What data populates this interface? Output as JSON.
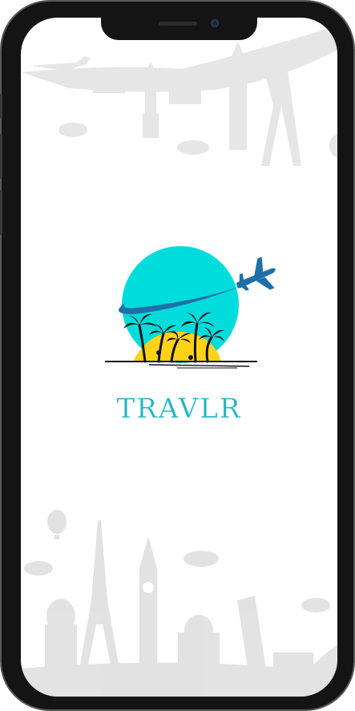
{
  "app": {
    "brand_name": "TRAVLR"
  },
  "colors": {
    "brand_text": "#1fb6c4",
    "sun_circle": "#00dcdc",
    "plane": "#1f6fa8",
    "island_sun": "#ffd21a",
    "palms": "#111111",
    "skyline": "#d9d9d9",
    "phone_frame": "#141414"
  },
  "icons": {
    "logo": "travel-logo-icon",
    "top_skyline": "skyline-landmarks-icon",
    "bottom_skyline": "skyline-landmarks-icon"
  }
}
